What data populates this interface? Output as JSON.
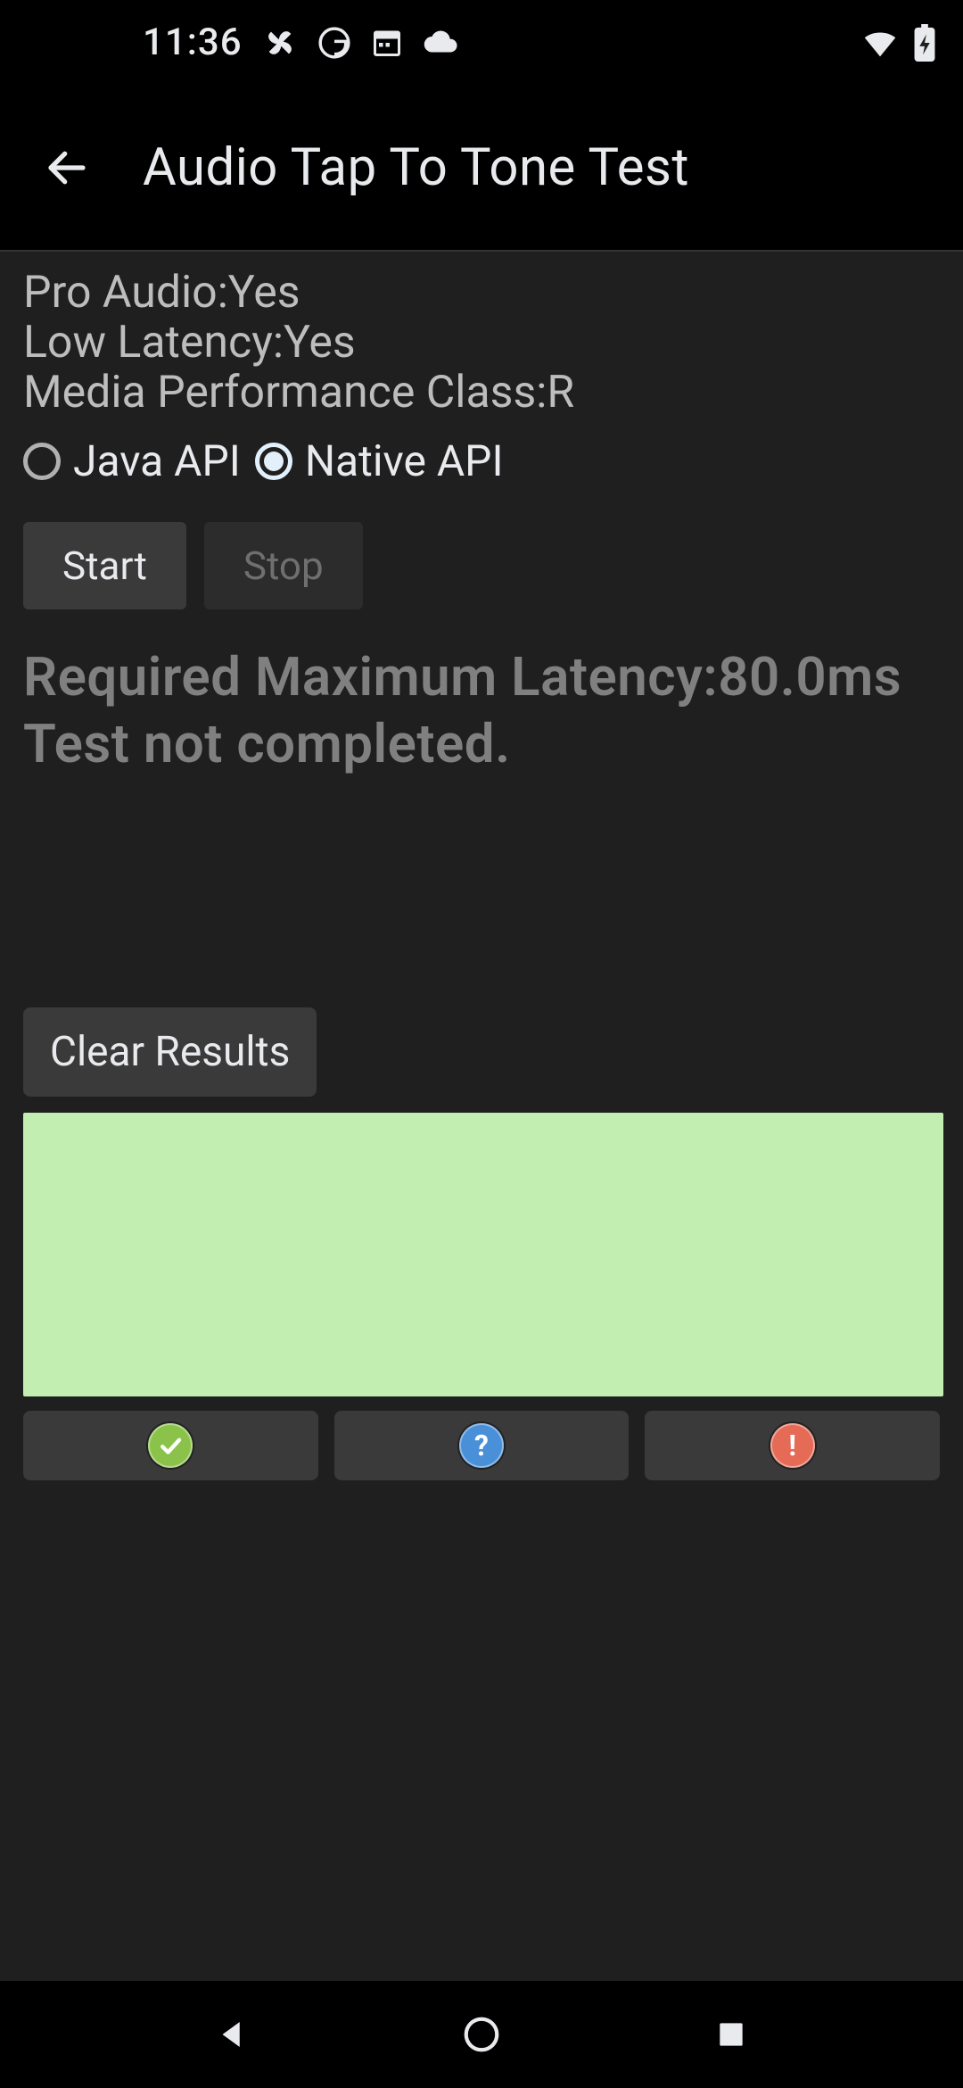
{
  "status_bar": {
    "time": "11:36"
  },
  "app_bar": {
    "title": "Audio Tap To Tone Test"
  },
  "info": {
    "pro_audio": "Pro Audio:Yes",
    "low_latency": "Low Latency:Yes",
    "media_perf": "Media Performance Class:R"
  },
  "radios": {
    "java": {
      "label": "Java API",
      "selected": false
    },
    "native": {
      "label": "Native API",
      "selected": true
    }
  },
  "buttons": {
    "start": "Start",
    "stop": "Stop",
    "clear": "Clear Results"
  },
  "status": {
    "required_latency": "Required Maximum Latency:80.0ms",
    "test_not_completed": "Test not completed."
  },
  "colors": {
    "green_panel": "#c2eeb1",
    "pass_badge": "#8bc34a",
    "info_badge": "#4a90d9",
    "fail_badge": "#e66b57"
  }
}
